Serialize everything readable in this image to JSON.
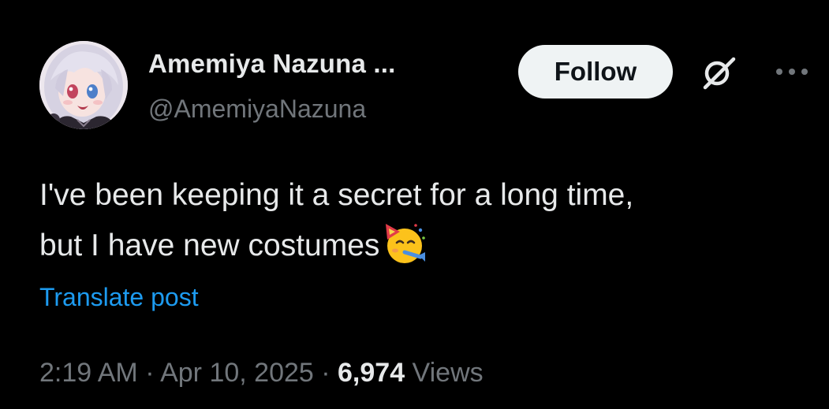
{
  "author": {
    "display_name": "Amemiya Nazuna ...",
    "handle": "@AmemiyaNazuna"
  },
  "actions": {
    "follow_label": "Follow",
    "grok_icon": "grok-icon",
    "more_icon": "more-options-icon"
  },
  "post": {
    "text_line_1": "I've been keeping it a secret for a long time,",
    "text_line_2": "but I have new costumes",
    "emoji": "partying-face-emoji",
    "translate_label": "Translate post"
  },
  "meta": {
    "time": "2:19 AM",
    "separator_1": " · ",
    "date": "Apr 10, 2025",
    "separator_2": " · ",
    "views_count": "6,974",
    "views_label": " Views"
  },
  "colors": {
    "background": "#000000",
    "primary_text": "#e7e9ea",
    "secondary_text": "#71767b",
    "link": "#1d9bf0",
    "follow_bg": "#eff3f4"
  }
}
